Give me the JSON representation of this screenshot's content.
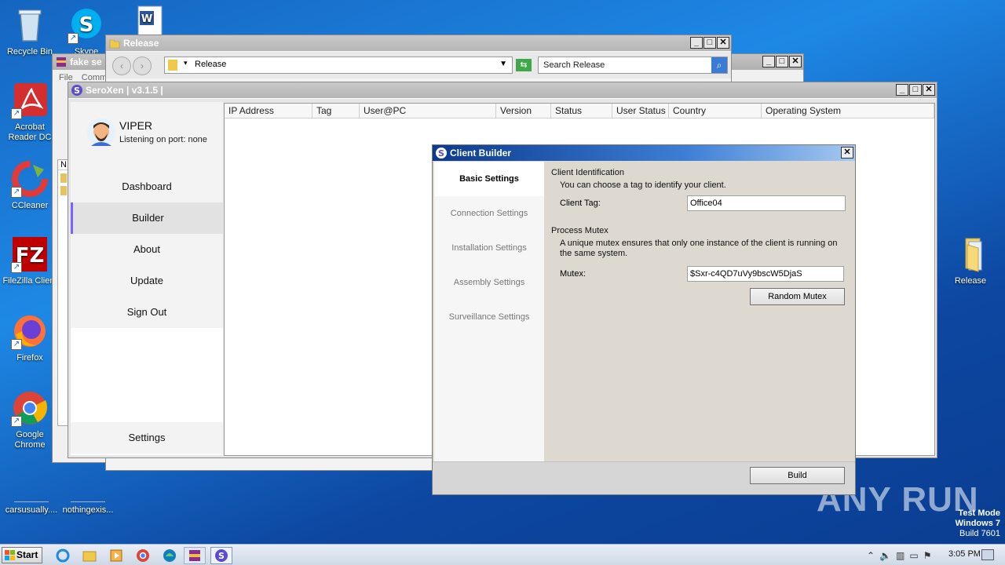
{
  "desktop": {
    "icons": {
      "recycle_bin": "Recycle Bin",
      "skype": "Skype",
      "acrobat": "Acrobat Reader DC",
      "ccleaner": "CCleaner",
      "filezilla": "FileZilla Client",
      "firefox": "Firefox",
      "chrome": "Google Chrome",
      "release": "Release",
      "file1": "carsusually....",
      "file2": "nothingexis..."
    },
    "watermark": {
      "brand": "ANY RUN",
      "test_mode": "Test Mode",
      "os": "Windows 7",
      "build": "Build 7601"
    }
  },
  "explorer": {
    "title": "Release",
    "address": "Release",
    "search_placeholder": "Search Release"
  },
  "rar_window": {
    "title": "fake se",
    "menu_file": "File",
    "menu_commands": "Comm",
    "col_n": "N"
  },
  "seroxen": {
    "title": "SeroXen | v3.1.5 |",
    "user_name": "VIPER",
    "user_status": "Listening on port: none",
    "nav": [
      "Dashboard",
      "Builder",
      "About",
      "Update",
      "Sign Out"
    ],
    "settings_label": "Settings",
    "columns": [
      "IP Address",
      "Tag",
      "User@PC",
      "Version",
      "Status",
      "User Status",
      "Country",
      "Operating System"
    ]
  },
  "client_builder": {
    "title": "Client Builder",
    "tabs": [
      "Basic Settings",
      "Connection Settings",
      "Installation Settings",
      "Assembly Settings",
      "Surveillance Settings"
    ],
    "client_identification": {
      "heading": "Client Identification",
      "description": "You can choose a tag to identify your client.",
      "tag_label": "Client Tag:",
      "tag_value": "Office04"
    },
    "process_mutex": {
      "heading": "Process Mutex",
      "description": "A unique mutex ensures that only one instance of the client is running on the same system.",
      "mutex_label": "Mutex:",
      "mutex_value": "$Sxr-c4QD7uVy9bscW5DjaS",
      "random_button": "Random Mutex"
    },
    "build_button": "Build"
  },
  "taskbar": {
    "start": "Start",
    "time": "3:05 PM"
  },
  "colors": {
    "accent": "#7b61ff",
    "desktop": "#1e88e5"
  }
}
